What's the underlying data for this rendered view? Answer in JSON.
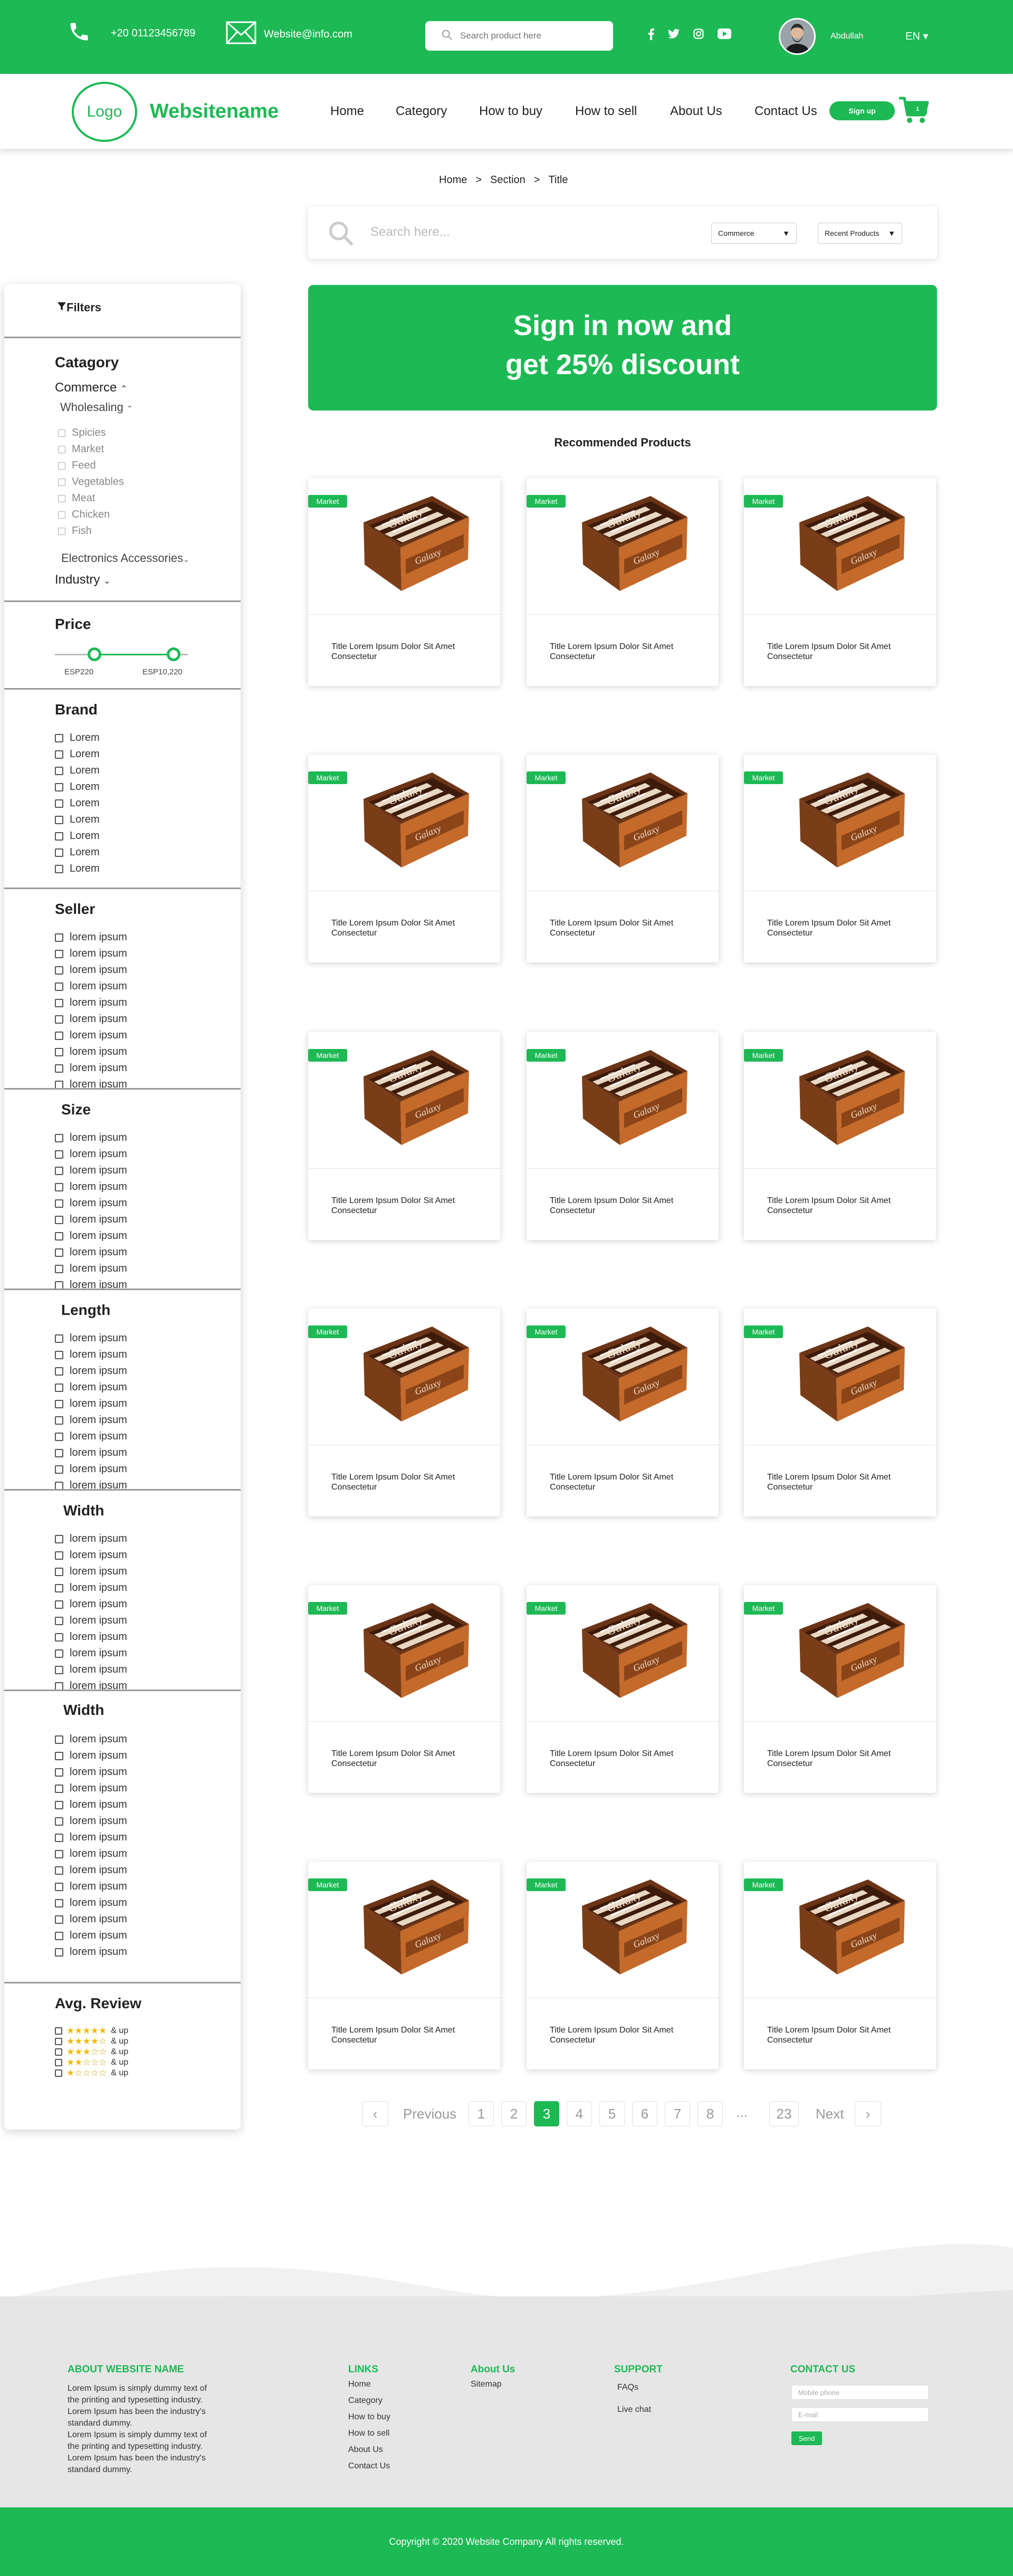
{
  "topbar": {
    "phone": "+20 01123456789",
    "email": "Website@info.com",
    "search_placeholder": "Search product here",
    "user_name": "Abdullah",
    "language": "EN",
    "social_icons": [
      "facebook-icon",
      "twitter-icon",
      "instagram-icon",
      "youtube-icon"
    ]
  },
  "nav": {
    "logo": "Logo",
    "site_name": "Websitename",
    "links": [
      "Home",
      "Category",
      "How to buy",
      "How to sell",
      "About Us",
      "Contact Us"
    ],
    "signup": "Sign up"
  },
  "breadcrumb": [
    "Home",
    ">",
    "Section",
    ">",
    "Title"
  ],
  "search": {
    "placeholder": "Search here...",
    "dropdown1": "Commerce",
    "dropdown2": "Recent Products"
  },
  "sidebar": {
    "filters": "Filters",
    "category": {
      "title": "Catagory",
      "commerce": "Commerce",
      "wholesaling": "Wholesaling",
      "items": [
        "Spicies",
        "Market",
        "Feed",
        "Vegetables",
        "Meat",
        "Chicken",
        "Fish"
      ],
      "electronics": "Electronics Accessories",
      "industry": "Industry"
    },
    "price": {
      "title": "Price",
      "min": "ESP220",
      "max": "ESP10,220"
    },
    "brand": {
      "title": "Brand",
      "items": [
        "Lorem",
        "Lorem",
        "Lorem",
        "Lorem",
        "Lorem",
        "Lorem",
        "Lorem",
        "Lorem",
        "Lorem"
      ]
    },
    "seller": {
      "title": "Seller",
      "items": [
        "lorem ipsum",
        "lorem ipsum",
        "lorem ipsum",
        "lorem ipsum",
        "lorem ipsum",
        "lorem ipsum",
        "lorem ipsum",
        "lorem ipsum",
        "lorem ipsum",
        "lorem ipsum"
      ]
    },
    "size": {
      "title": "Size",
      "items": [
        "lorem ipsum",
        "lorem ipsum",
        "lorem ipsum",
        "lorem ipsum",
        "lorem ipsum",
        "lorem ipsum",
        "lorem ipsum",
        "lorem ipsum",
        "lorem ipsum",
        "lorem ipsum"
      ]
    },
    "length": {
      "title": "Length",
      "items": [
        "lorem ipsum",
        "lorem ipsum",
        "lorem ipsum",
        "lorem ipsum",
        "lorem ipsum",
        "lorem ipsum",
        "lorem ipsum",
        "lorem ipsum",
        "lorem ipsum",
        "lorem ipsum"
      ]
    },
    "width1": {
      "title": "Width",
      "items": [
        "lorem ipsum",
        "lorem ipsum",
        "lorem ipsum",
        "lorem ipsum",
        "lorem ipsum",
        "lorem ipsum",
        "lorem ipsum",
        "lorem ipsum",
        "lorem ipsum",
        "lorem ipsum"
      ]
    },
    "width2": {
      "title": "Width",
      "items": [
        "lorem ipsum",
        "lorem ipsum",
        "lorem ipsum",
        "lorem ipsum",
        "lorem ipsum",
        "lorem ipsum",
        "lorem ipsum",
        "lorem ipsum",
        "lorem ipsum",
        "lorem ipsum",
        "lorem ipsum",
        "lorem ipsum",
        "lorem ipsum",
        "lorem ipsum"
      ]
    },
    "review": {
      "title": "Avg. Review",
      "up": "& up",
      "stars": [
        5,
        4,
        3,
        2,
        1
      ]
    }
  },
  "banner": {
    "line1": "Sign in now and",
    "line2": "get 25% discount"
  },
  "recommended": "Recommended Products",
  "product": {
    "badge": "Market",
    "title": "Title Lorem Ipsum Dolor Sit Amet Consectetur"
  },
  "pagination": {
    "previous": "Previous",
    "next": "Next",
    "pages": [
      "1",
      "2",
      "3",
      "4",
      "5",
      "6",
      "7",
      "8",
      "...",
      "23"
    ],
    "current": "3"
  },
  "footer": {
    "about_title": "ABOUT WEBSITE NAME",
    "about_text1": "Lorem Ipsum is simply dummy text of the printing and typesetting industry. Lorem Ipsum has been the industry's standard dummy.",
    "about_text2": "Lorem Ipsum is simply dummy text of the printing and typesetting industry. Lorem Ipsum has been the industry's standard dummy.",
    "links_title": "LINKS",
    "links": [
      "Home",
      "Category",
      "How to buy",
      "How to sell",
      "About Us",
      "Contact Us"
    ],
    "aboutus_title": "About Us",
    "aboutus_links": [
      "Sitemap"
    ],
    "support_title": "SUPPORT",
    "support_links": [
      "FAQs",
      "Live chat"
    ],
    "contact_title": "CONTACT US",
    "contact_phone_placeholder": "Mobile phone",
    "contact_email_placeholder": "E-mail",
    "send": "Send",
    "copyright": "Copyright © 2020 Website Company All rights reserved."
  },
  "colors": {
    "accent": "#1db954",
    "footer_bg": "#e6e6e6"
  }
}
